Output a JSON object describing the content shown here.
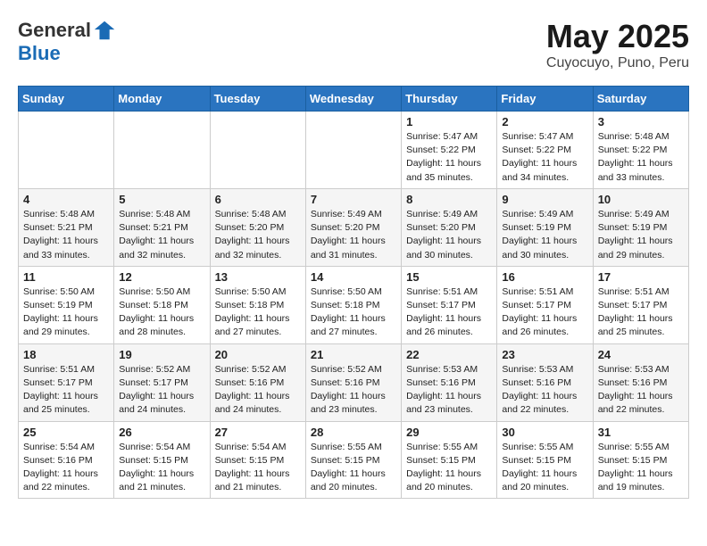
{
  "header": {
    "logo_line1": "General",
    "logo_line2": "Blue",
    "month_title": "May 2025",
    "location": "Cuyocuyo, Puno, Peru"
  },
  "weekdays": [
    "Sunday",
    "Monday",
    "Tuesday",
    "Wednesday",
    "Thursday",
    "Friday",
    "Saturday"
  ],
  "weeks": [
    [
      {
        "day": "",
        "info": ""
      },
      {
        "day": "",
        "info": ""
      },
      {
        "day": "",
        "info": ""
      },
      {
        "day": "",
        "info": ""
      },
      {
        "day": "1",
        "info": "Sunrise: 5:47 AM\nSunset: 5:22 PM\nDaylight: 11 hours and 35 minutes."
      },
      {
        "day": "2",
        "info": "Sunrise: 5:47 AM\nSunset: 5:22 PM\nDaylight: 11 hours and 34 minutes."
      },
      {
        "day": "3",
        "info": "Sunrise: 5:48 AM\nSunset: 5:22 PM\nDaylight: 11 hours and 33 minutes."
      }
    ],
    [
      {
        "day": "4",
        "info": "Sunrise: 5:48 AM\nSunset: 5:21 PM\nDaylight: 11 hours and 33 minutes."
      },
      {
        "day": "5",
        "info": "Sunrise: 5:48 AM\nSunset: 5:21 PM\nDaylight: 11 hours and 32 minutes."
      },
      {
        "day": "6",
        "info": "Sunrise: 5:48 AM\nSunset: 5:20 PM\nDaylight: 11 hours and 32 minutes."
      },
      {
        "day": "7",
        "info": "Sunrise: 5:49 AM\nSunset: 5:20 PM\nDaylight: 11 hours and 31 minutes."
      },
      {
        "day": "8",
        "info": "Sunrise: 5:49 AM\nSunset: 5:20 PM\nDaylight: 11 hours and 30 minutes."
      },
      {
        "day": "9",
        "info": "Sunrise: 5:49 AM\nSunset: 5:19 PM\nDaylight: 11 hours and 30 minutes."
      },
      {
        "day": "10",
        "info": "Sunrise: 5:49 AM\nSunset: 5:19 PM\nDaylight: 11 hours and 29 minutes."
      }
    ],
    [
      {
        "day": "11",
        "info": "Sunrise: 5:50 AM\nSunset: 5:19 PM\nDaylight: 11 hours and 29 minutes."
      },
      {
        "day": "12",
        "info": "Sunrise: 5:50 AM\nSunset: 5:18 PM\nDaylight: 11 hours and 28 minutes."
      },
      {
        "day": "13",
        "info": "Sunrise: 5:50 AM\nSunset: 5:18 PM\nDaylight: 11 hours and 27 minutes."
      },
      {
        "day": "14",
        "info": "Sunrise: 5:50 AM\nSunset: 5:18 PM\nDaylight: 11 hours and 27 minutes."
      },
      {
        "day": "15",
        "info": "Sunrise: 5:51 AM\nSunset: 5:17 PM\nDaylight: 11 hours and 26 minutes."
      },
      {
        "day": "16",
        "info": "Sunrise: 5:51 AM\nSunset: 5:17 PM\nDaylight: 11 hours and 26 minutes."
      },
      {
        "day": "17",
        "info": "Sunrise: 5:51 AM\nSunset: 5:17 PM\nDaylight: 11 hours and 25 minutes."
      }
    ],
    [
      {
        "day": "18",
        "info": "Sunrise: 5:51 AM\nSunset: 5:17 PM\nDaylight: 11 hours and 25 minutes."
      },
      {
        "day": "19",
        "info": "Sunrise: 5:52 AM\nSunset: 5:17 PM\nDaylight: 11 hours and 24 minutes."
      },
      {
        "day": "20",
        "info": "Sunrise: 5:52 AM\nSunset: 5:16 PM\nDaylight: 11 hours and 24 minutes."
      },
      {
        "day": "21",
        "info": "Sunrise: 5:52 AM\nSunset: 5:16 PM\nDaylight: 11 hours and 23 minutes."
      },
      {
        "day": "22",
        "info": "Sunrise: 5:53 AM\nSunset: 5:16 PM\nDaylight: 11 hours and 23 minutes."
      },
      {
        "day": "23",
        "info": "Sunrise: 5:53 AM\nSunset: 5:16 PM\nDaylight: 11 hours and 22 minutes."
      },
      {
        "day": "24",
        "info": "Sunrise: 5:53 AM\nSunset: 5:16 PM\nDaylight: 11 hours and 22 minutes."
      }
    ],
    [
      {
        "day": "25",
        "info": "Sunrise: 5:54 AM\nSunset: 5:16 PM\nDaylight: 11 hours and 22 minutes."
      },
      {
        "day": "26",
        "info": "Sunrise: 5:54 AM\nSunset: 5:15 PM\nDaylight: 11 hours and 21 minutes."
      },
      {
        "day": "27",
        "info": "Sunrise: 5:54 AM\nSunset: 5:15 PM\nDaylight: 11 hours and 21 minutes."
      },
      {
        "day": "28",
        "info": "Sunrise: 5:55 AM\nSunset: 5:15 PM\nDaylight: 11 hours and 20 minutes."
      },
      {
        "day": "29",
        "info": "Sunrise: 5:55 AM\nSunset: 5:15 PM\nDaylight: 11 hours and 20 minutes."
      },
      {
        "day": "30",
        "info": "Sunrise: 5:55 AM\nSunset: 5:15 PM\nDaylight: 11 hours and 20 minutes."
      },
      {
        "day": "31",
        "info": "Sunrise: 5:55 AM\nSunset: 5:15 PM\nDaylight: 11 hours and 19 minutes."
      }
    ]
  ]
}
